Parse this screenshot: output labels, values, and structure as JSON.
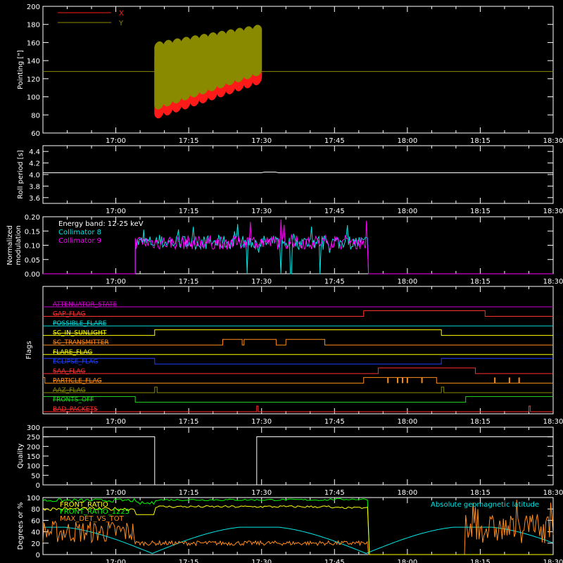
{
  "chart_data": [
    {
      "id": "pointing",
      "type": "line",
      "ylabel": "Pointing [\"]",
      "ylim": [
        60,
        200
      ],
      "yticks": [
        60,
        80,
        100,
        120,
        140,
        160,
        180,
        200
      ],
      "xlim": [
        "16:45",
        "18:30"
      ],
      "xtick_labels": [
        "17:00",
        "17:15",
        "17:30",
        "17:45",
        "18:00",
        "18:15",
        "18:30"
      ],
      "legend": [
        {
          "name": "X",
          "color": "#ff1a1a"
        },
        {
          "name": "Y",
          "color": "#8a8a00"
        }
      ],
      "series": [
        {
          "name": "X",
          "color": "#ff1a1a",
          "start": "17:08",
          "end": "17:30",
          "y_low_start": 75,
          "y_low_end": 115,
          "y_high_start": 150,
          "y_high_end": 135
        },
        {
          "name": "Y",
          "color": "#8a8a00",
          "start": "17:08",
          "end": "17:30",
          "y_low_start": 85,
          "y_low_end": 125,
          "y_high_start": 160,
          "y_high_end": 180
        }
      ],
      "reference_line": {
        "y": 128,
        "color": "#8a8a00"
      }
    },
    {
      "id": "roll",
      "type": "line",
      "ylabel": "Roll period [s]",
      "ylim": [
        3.5,
        4.5
      ],
      "yticks": [
        3.6,
        3.8,
        4.0,
        4.2,
        4.4
      ],
      "ytick_labels": [
        "3.6",
        "3.8",
        "4.0",
        "4.2",
        "4.4"
      ],
      "xtick_labels": [
        "17:00",
        "17:15",
        "17:30",
        "17:45",
        "18:00",
        "18:15",
        "18:30"
      ],
      "series": [
        {
          "name": "",
          "color": "#ffffff",
          "value": 4.03
        }
      ]
    },
    {
      "id": "modulation",
      "type": "line",
      "ylabel": "Normalized modulation",
      "ylim": [
        0,
        0.2
      ],
      "yticks": [
        0.0,
        0.05,
        0.1,
        0.15,
        0.2
      ],
      "ytick_labels": [
        "0.00",
        "0.05",
        "0.10",
        "0.15",
        "0.20"
      ],
      "xtick_labels": [
        "17:00",
        "17:15",
        "17:30",
        "17:45",
        "18:00",
        "18:15",
        "18:30"
      ],
      "annotation": "Energy band: 12-25 keV",
      "legend": [
        {
          "name": "Collimator 8",
          "color": "#00e5e5"
        },
        {
          "name": "Collimator 9",
          "color": "#ff00ff"
        }
      ],
      "active_start": "17:04",
      "active_end": "17:52",
      "level": 0.11,
      "cyan_dropouts": [
        "17:27",
        "17:34",
        "17:36",
        "17:42"
      ]
    },
    {
      "id": "flags",
      "type": "line",
      "ylabel": "Flags",
      "xtick_labels": [
        "17:00",
        "17:15",
        "17:30",
        "17:45",
        "18:00",
        "18:15",
        "18:30"
      ],
      "flags": [
        {
          "name": "ATTENUATOR_STATE",
          "color": "#cc00cc",
          "transitions": []
        },
        {
          "name": "GAP_FLAG",
          "color": "#ff3030",
          "transitions": [
            [
              "17:51",
              1
            ],
            [
              "18:16",
              0
            ]
          ]
        },
        {
          "name": "POSSIBLE_FLARE",
          "color": "#00dddd",
          "transitions": []
        },
        {
          "name": "SC_IN_SUNLIGHT",
          "color": "#ffff00",
          "transitions": [
            [
              "17:08",
              1
            ],
            [
              "18:07",
              0
            ]
          ]
        },
        {
          "name": "SC_TRANSMITTER",
          "color": "#ff8c1a",
          "transitions": [
            [
              "17:22",
              1
            ],
            [
              "17:26",
              0
            ],
            [
              "17:26.4",
              1
            ],
            [
              "17:33",
              0
            ],
            [
              "17:35",
              1
            ],
            [
              "17:43",
              0
            ]
          ]
        },
        {
          "name": "FLARE_FLAG",
          "color": "#ffff00",
          "transitions": []
        },
        {
          "name": "ECLIPSE_FLAG",
          "color": "#1f3fff",
          "initial": 1,
          "transitions": [
            [
              "17:08",
              0
            ],
            [
              "18:07",
              1
            ]
          ]
        },
        {
          "name": "SAA_FLAG",
          "color": "#ff3030",
          "transitions": [
            [
              "17:54",
              1
            ],
            [
              "18:14",
              0
            ]
          ]
        },
        {
          "name": "PARTICLE_FLAG",
          "color": "#ff8c1a",
          "initial": 1,
          "transitions": [
            [
              "16:45.4",
              0
            ],
            [
              "17:51",
              1
            ],
            [
              "18:06",
              0
            ]
          ]
        },
        {
          "name": "AAZ_FLAG",
          "color": "#8a8a00",
          "transitions": [
            [
              "17:08",
              1
            ],
            [
              "17:08.5",
              0
            ],
            [
              "18:07",
              1
            ],
            [
              "18:07.5",
              0
            ]
          ]
        },
        {
          "name": "FRONTS_OFF",
          "color": "#22cc22",
          "initial": 1,
          "transitions": [
            [
              "17:04",
              0
            ],
            [
              "18:12",
              1
            ]
          ]
        },
        {
          "name": "BAD_PACKETS",
          "color": "#ff3030",
          "transitions": [
            [
              "17:29",
              1
            ],
            [
              "17:29.3",
              0
            ],
            [
              "18:25",
              1
            ],
            [
              "18:25.3",
              0
            ]
          ]
        }
      ]
    },
    {
      "id": "quality",
      "type": "line",
      "ylabel": "Quality",
      "ylim": [
        0,
        300
      ],
      "yticks": [
        0,
        50,
        100,
        150,
        200,
        250,
        300
      ],
      "xtick_labels": [
        "17:00",
        "17:15",
        "17:30",
        "17:45",
        "18:00",
        "18:15",
        "18:30"
      ],
      "series": [
        {
          "name": "",
          "color": "#ffffff",
          "segments": [
            [
              "16:45",
              "17:08",
              250
            ],
            [
              "17:08",
              "17:29",
              0
            ],
            [
              "17:29",
              "18:30",
              250
            ]
          ]
        }
      ]
    },
    {
      "id": "ratios",
      "type": "line",
      "ylabel": "Degrees or %",
      "ylim": [
        0,
        100
      ],
      "yticks": [
        0,
        20,
        40,
        60,
        80,
        100
      ],
      "xtick_labels": [
        "17:00",
        "17:15",
        "17:30",
        "17:45",
        "18:00",
        "18:15",
        "18:30"
      ],
      "legend": [
        {
          "name": "FRONT_RATIO",
          "color": "#ffff00"
        },
        {
          "name": "FRONT_RATIO_1225",
          "color": "#00ff00"
        },
        {
          "name": "MAX_DET_VS_TOT",
          "color": "#ff8c1a"
        }
      ],
      "annotation": "Absolute geomagnetic latitude",
      "annotation_color": "#00e5e5"
    }
  ]
}
